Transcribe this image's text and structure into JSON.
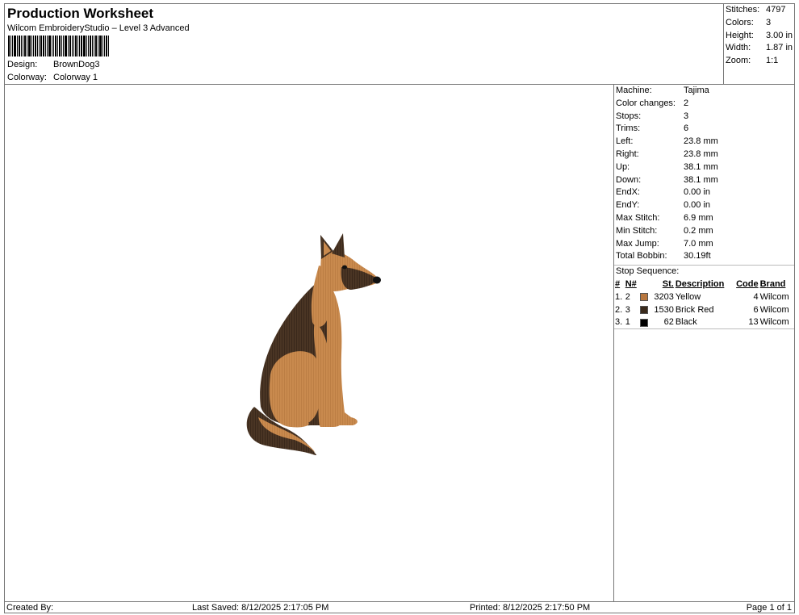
{
  "header": {
    "title": "Production Worksheet",
    "subtitle": "Wilcom EmbroideryStudio – Level 3 Advanced",
    "design_label": "Design:",
    "design_value": "BrownDog3",
    "colorway_label": "Colorway:",
    "colorway_value": "Colorway 1"
  },
  "summary": [
    {
      "label": "Stitches:",
      "value": "4797"
    },
    {
      "label": "Colors:",
      "value": "3"
    },
    {
      "label": "Height:",
      "value": "3.00 in"
    },
    {
      "label": "Width:",
      "value": "1.87 in"
    },
    {
      "label": "Zoom:",
      "value": "1:1"
    }
  ],
  "details": [
    {
      "label": "Machine:",
      "value": "Tajima"
    },
    {
      "label": "Color changes:",
      "value": "2"
    },
    {
      "label": "Stops:",
      "value": "3"
    },
    {
      "label": "Trims:",
      "value": "6"
    },
    {
      "label": "Left:",
      "value": "23.8 mm"
    },
    {
      "label": "Right:",
      "value": "23.8 mm"
    },
    {
      "label": "Up:",
      "value": "38.1 mm"
    },
    {
      "label": "Down:",
      "value": "38.1 mm"
    },
    {
      "label": "EndX:",
      "value": "0.00 in"
    },
    {
      "label": "EndY:",
      "value": "0.00 in"
    },
    {
      "label": "Max Stitch:",
      "value": "6.9 mm"
    },
    {
      "label": "Min Stitch:",
      "value": "0.2 mm"
    },
    {
      "label": "Max Jump:",
      "value": "7.0 mm"
    },
    {
      "label": "Total Bobbin:",
      "value": "30.19ft"
    }
  ],
  "stop_sequence": {
    "label": "Stop Sequence:",
    "columns": [
      "#",
      "N#",
      "St.",
      "Description",
      "Code",
      "Brand"
    ],
    "rows": [
      {
        "idx": "1.",
        "n": "2",
        "color": "#b8773f",
        "st": "3203",
        "desc": "Yellow",
        "code": "4",
        "brand": "Wilcom"
      },
      {
        "idx": "2.",
        "n": "3",
        "color": "#3a2a1c",
        "st": "1530",
        "desc": "Brick Red",
        "code": "6",
        "brand": "Wilcom"
      },
      {
        "idx": "3.",
        "n": "1",
        "color": "#000000",
        "st": "62",
        "desc": "Black",
        "code": "13",
        "brand": "Wilcom"
      }
    ]
  },
  "footer": {
    "created_by": "Created By:",
    "last_saved": "Last Saved: 8/12/2025 2:17:05 PM",
    "printed": "Printed: 8/12/2025 2:17:50 PM",
    "page": "Page 1 of 1"
  },
  "colors": {
    "tan": "#c98a4e",
    "dark_brown": "#3d2c1e",
    "black": "#111111"
  }
}
